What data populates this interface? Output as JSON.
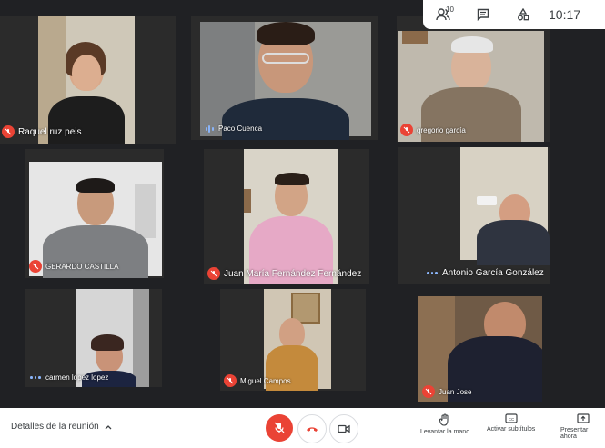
{
  "participants": [
    {
      "name": "Raquel ruz peis",
      "status": "muted"
    },
    {
      "name": "Paco Cuenca",
      "status": "speaking"
    },
    {
      "name": "gregorio garcía",
      "status": "muted"
    },
    {
      "name": "GERARDO CASTILLA",
      "status": "muted"
    },
    {
      "name": "Juan María Fernández Fernández",
      "status": "muted"
    },
    {
      "name": "Antonio García González",
      "status": "idle"
    },
    {
      "name": "carmen lopez lopez",
      "status": "idle"
    },
    {
      "name": "Miguel Campos",
      "status": "muted"
    },
    {
      "name": "Juan Jose",
      "status": "muted"
    }
  ],
  "topbar": {
    "participants_count": "10",
    "time": "10:17"
  },
  "bottombar": {
    "details_label": "Detalles de la reunión",
    "raise_hand_label": "Levantar la mano",
    "captions_label": "Activar subtítulos",
    "present_label": "Presentar ahora"
  },
  "colors": {
    "background": "#202124",
    "mute_red": "#ea4335",
    "accent_blue": "#8ab4f8"
  }
}
